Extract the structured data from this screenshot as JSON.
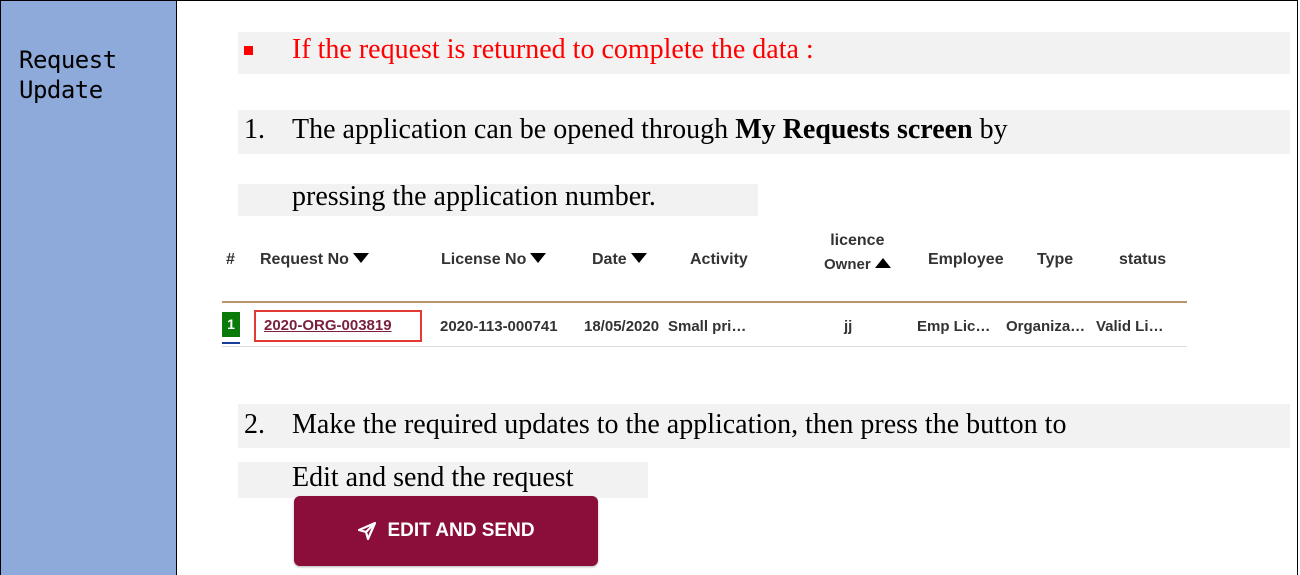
{
  "section": {
    "title_line1": "Request",
    "title_line2": "Update"
  },
  "content": {
    "bullet_text": "If the request is returned to complete the data :",
    "step1_num": "1.",
    "step1_pre": "The application can be opened through ",
    "step1_bold": "My Requests screen",
    "step1_post": " by",
    "step1_line2": "pressing the application number.",
    "step2_num": "2.",
    "step2_line1": "Make the required updates to the application, then press the button to",
    "step2_line2": "Edit and send the request"
  },
  "table": {
    "headers": {
      "hash": "#",
      "request_no": "Request No",
      "license_no": "License No",
      "date": "Date",
      "activity": "Activity",
      "owner_line1": "licence",
      "owner_line2": "Owner",
      "employee": "Employee",
      "type": "Type",
      "status": "status"
    },
    "row": {
      "index": "1",
      "request_no": "2020-ORG-003819",
      "license_no": "2020-113-000741",
      "date": "18/05/2020",
      "activity": "Small pri…",
      "owner": "jj",
      "employee": "Emp Lic…",
      "type": "Organiza…",
      "status": "Valid Li…"
    }
  },
  "button": {
    "label": "EDIT AND SEND",
    "icon": "send-icon",
    "color": "#8b0e3a"
  },
  "colors": {
    "sidebar": "#8eaadb",
    "highlight": "#ff0000"
  }
}
